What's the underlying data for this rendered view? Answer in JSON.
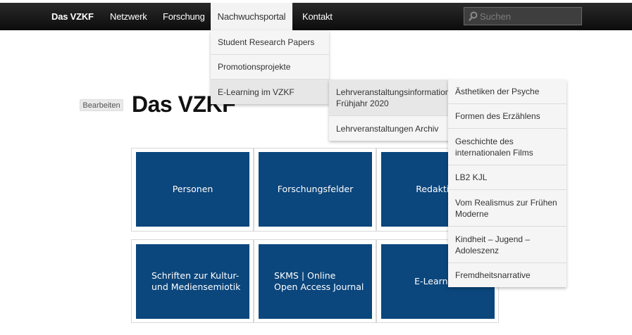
{
  "nav": {
    "brand": "Das VZKF",
    "items": [
      "Netzwerk",
      "Forschung",
      "Nachwuchsportal",
      "Kontakt"
    ],
    "search_placeholder": "Suchen"
  },
  "dropdown1": [
    "Student Research Papers",
    "Promotionsprojekte",
    "E-Learning im VZKF"
  ],
  "dropdown2": [
    "Lehrveranstaltungsinformation\nFrühjahr 2020",
    "Lehrveranstaltungen Archiv"
  ],
  "dropdown3": [
    "Ästhetiken der Psyche",
    "Formen des Erzählens",
    "Geschichte des\ninternationalen Films",
    "LB2 KJL",
    "Vom Realismus zur Frühen\nModerne",
    "Kindheit – Jugend –\nAdoleszenz",
    "Fremdheitsnarrative"
  ],
  "page": {
    "edit_label": "Bearbeiten",
    "title": "Das VZKF"
  },
  "tiles": [
    "Personen",
    "Forschungsfelder",
    "Redaktion",
    "Schriften zur Kultur-\nund Mediensemiotik",
    "SKMS | Online\nOpen Access Journal",
    "E-Learning"
  ],
  "colors": {
    "tile_blue": "#0b467c",
    "nav_bg": "#111111"
  }
}
